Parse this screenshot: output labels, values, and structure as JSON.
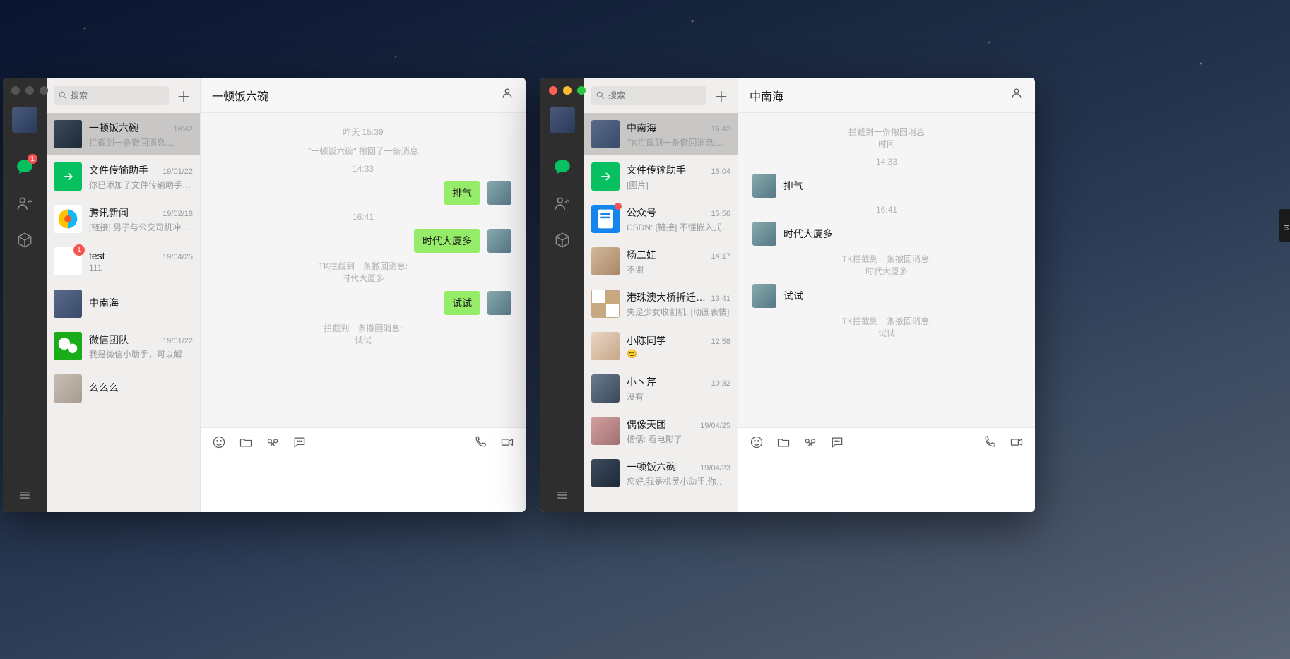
{
  "search_placeholder": "搜索",
  "left": {
    "sidebar_badge": "1",
    "title": "一顿饭六碗",
    "chats": [
      {
        "name": "一顿饭六碗",
        "time": "16:42",
        "preview": "拦截到一条撤回消息:...",
        "avatar": "av-dark",
        "selected": true
      },
      {
        "name": "文件传输助手",
        "time": "19/01/22",
        "preview": "你已添加了文件传输助手，现...",
        "avatar": "av-green"
      },
      {
        "name": "腾讯新闻",
        "time": "19/02/18",
        "preview": "[链接] 男子与公交司机冲突 被...",
        "avatar": "av-qq"
      },
      {
        "name": "test",
        "time": "19/04/25",
        "preview": "111",
        "avatar": "av-panda",
        "badge": "1"
      },
      {
        "name": "中南海",
        "time": "",
        "preview": "",
        "avatar": "av-blue2"
      },
      {
        "name": "微信团队",
        "time": "19/01/22",
        "preview": "我是微信小助手，可以解答你...",
        "avatar": "av-wx"
      },
      {
        "name": "么么么",
        "time": "",
        "preview": "",
        "avatar": "av-grey"
      }
    ],
    "thread": [
      {
        "type": "sys",
        "text": "昨天 15:39"
      },
      {
        "type": "sys",
        "text": "\"一顿饭六碗\" 撤回了一条消息"
      },
      {
        "type": "sys",
        "text": "14:33"
      },
      {
        "type": "out",
        "text": "排气"
      },
      {
        "type": "sys",
        "text": "16:41"
      },
      {
        "type": "out",
        "text": "时代大厦多"
      },
      {
        "type": "sys2",
        "l1": "TK拦截到一条撤回消息:",
        "l2": "时代大厦多"
      },
      {
        "type": "out",
        "text": "试试"
      },
      {
        "type": "sys2",
        "l1": "拦截到一条撤回消息:",
        "l2": "试试"
      }
    ]
  },
  "right": {
    "title": "中南海",
    "chats": [
      {
        "name": "中南海",
        "time": "16:42",
        "preview": "TK拦截到一条撤回消息:...",
        "avatar": "av-blue2",
        "selected": true
      },
      {
        "name": "文件传输助手",
        "time": "15:04",
        "preview": "[图片]",
        "avatar": "av-green"
      },
      {
        "name": "公众号",
        "time": "15:56",
        "preview": "CSDN: [链接] 不懂嵌入式、何...",
        "avatar": "av-doc",
        "reddot": true
      },
      {
        "name": "杨二娃",
        "time": "14:17",
        "preview": "不谢",
        "avatar": "av-couple"
      },
      {
        "name": "港珠澳大桥拆迁招...",
        "time": "13:41",
        "preview": "失足少女收割机: [动画表情]",
        "avatar": "av-grid"
      },
      {
        "name": "小陈同学",
        "time": "12:58",
        "preview": "😊",
        "avatar": "av-girl"
      },
      {
        "name": "小丶芹",
        "time": "10:32",
        "preview": "没有",
        "avatar": "av-boy"
      },
      {
        "name": "偶像天团",
        "time": "19/04/25",
        "preview": "杨儒: 看电影了",
        "avatar": "av-idol"
      },
      {
        "name": "一顿饭六碗",
        "time": "19/04/23",
        "preview": "您好,我是机灵小助手,你可以和...",
        "avatar": "av-dark"
      }
    ],
    "thread": [
      {
        "type": "sys2",
        "l1": "拦截到一条撤回消息",
        "l2": "时间"
      },
      {
        "type": "sys",
        "text": "14:33"
      },
      {
        "type": "in",
        "text": "排气"
      },
      {
        "type": "sys",
        "text": "16:41"
      },
      {
        "type": "in",
        "text": "时代大厦多"
      },
      {
        "type": "sys2",
        "l1": "TK拦截到一条撤回消息:",
        "l2": "时代大厦多"
      },
      {
        "type": "in",
        "text": "试试"
      },
      {
        "type": "sys2",
        "l1": "TK拦截到一条撤回消息:",
        "l2": "试试"
      }
    ]
  },
  "edge_label": "In"
}
